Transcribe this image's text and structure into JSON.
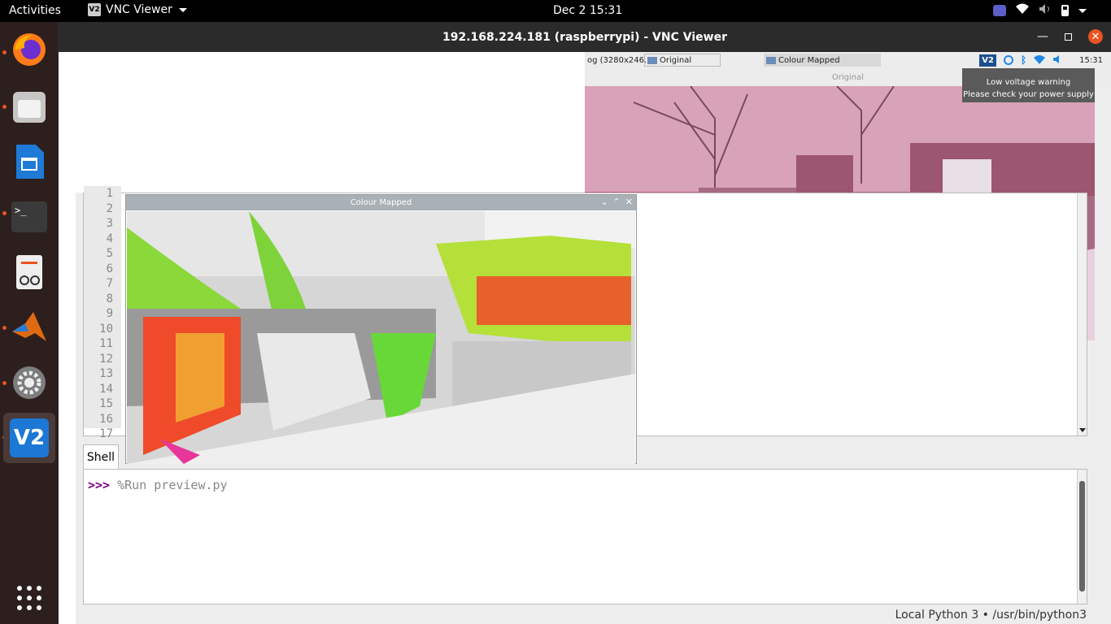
{
  "topbar": {
    "activities": "Activities",
    "app_icon": "V2",
    "app_name": "VNC Viewer",
    "clock": "Dec 2  15:31"
  },
  "dock": {
    "items": [
      "firefox",
      "files",
      "libreoffice-writer",
      "terminal",
      "document-viewer",
      "matlab",
      "settings",
      "vnc-viewer"
    ]
  },
  "vnc": {
    "title": "192.168.224.181 (raspberrypi) - VNC Viewer"
  },
  "rpi": {
    "taskbar": {
      "item1": "og (3280x246...",
      "item2": "Original",
      "item3": "Colour Mapped",
      "vnc_badge": "V2",
      "clock": "15:31"
    },
    "voltage_warning": {
      "line1": "Low voltage warning",
      "line2": "Please check your power supply"
    },
    "original_window": {
      "title": "Original"
    },
    "colour_window": {
      "title": "Colour Mapped"
    },
    "editor": {
      "line_numbers": [
        "1",
        "2",
        "3",
        "4",
        "5",
        "6",
        "7",
        "8",
        "9",
        "10",
        "11",
        "12",
        "13",
        "14",
        "15",
        "16",
        "17"
      ]
    },
    "shell": {
      "tab": "Shell",
      "prompt": ">>>",
      "command": "%Run preview.py"
    },
    "status": "Local Python 3  •  /usr/bin/python3"
  },
  "colors": {
    "ubuntu_orange": "#e95420",
    "dock_bg": "#2c1f1d"
  }
}
